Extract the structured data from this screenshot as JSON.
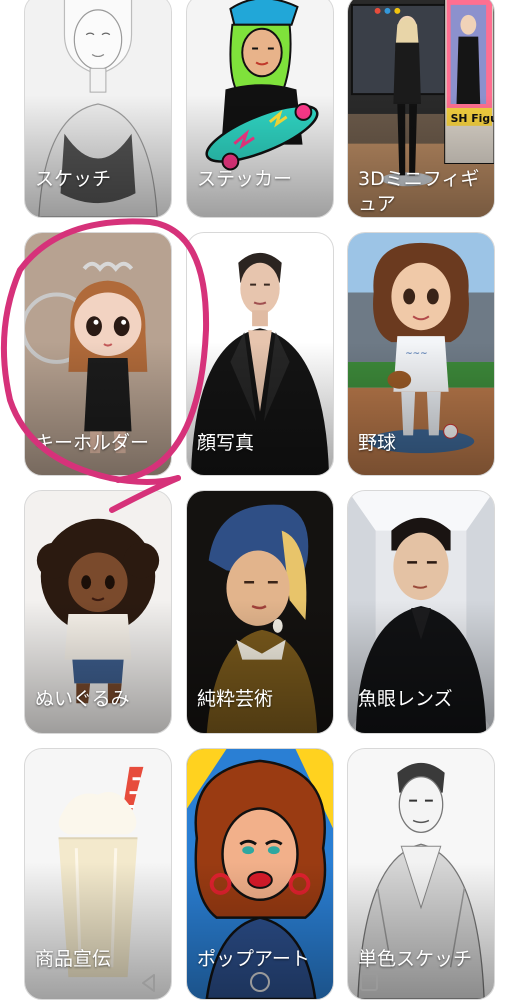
{
  "cards": [
    {
      "label": "スケッチ",
      "icon": "sketch-portrait-image"
    },
    {
      "label": "ステッカー",
      "icon": "sticker-skateboard-image"
    },
    {
      "label": "3Dミニフィギュア",
      "icon": "3d-figure-image"
    },
    {
      "label": "キーホルダー",
      "icon": "keychain-doll-image"
    },
    {
      "label": "顔写真",
      "icon": "headshot-image"
    },
    {
      "label": "野球",
      "icon": "baseball-bobblehead-image"
    },
    {
      "label": "ぬいぐるみ",
      "icon": "plush-doll-image"
    },
    {
      "label": "純粋芸術",
      "icon": "fine-art-painting-image"
    },
    {
      "label": "魚眼レンズ",
      "icon": "fisheye-portrait-image"
    },
    {
      "label": "商品宣伝",
      "icon": "milkshake-product-image"
    },
    {
      "label": "ポップアート",
      "icon": "pop-art-image"
    },
    {
      "label": "単色スケッチ",
      "icon": "monochrome-sketch-image"
    }
  ],
  "figure_box": {
    "brand": "SH Figuarts"
  },
  "annotation": {
    "color": "#d6327a"
  },
  "navbar": {
    "back": "back-icon",
    "home": "home-icon",
    "recents": "recents-icon"
  }
}
